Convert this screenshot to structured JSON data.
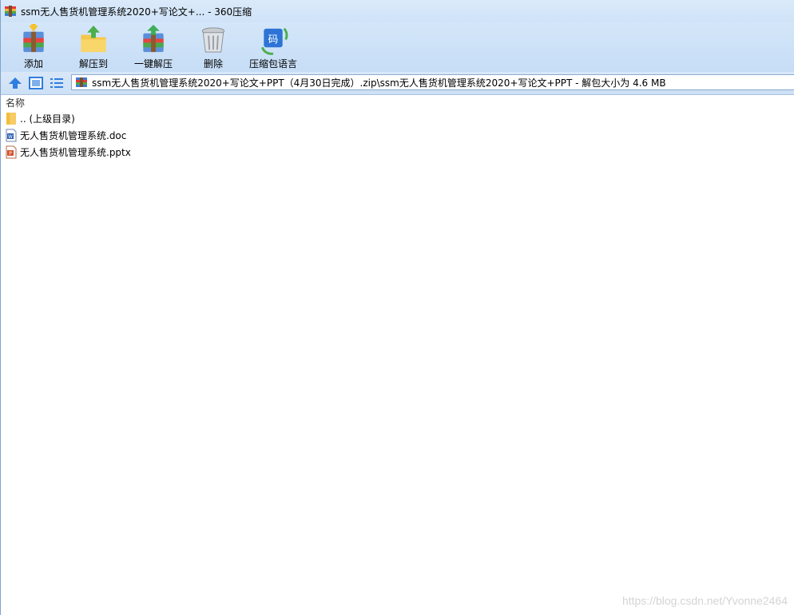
{
  "window": {
    "title": "ssm无人售货机管理系统2020+写论文+... - 360压缩",
    "icon": "archive-icon"
  },
  "toolbar": {
    "items": [
      {
        "label": "添加",
        "icon": "add-archive-icon"
      },
      {
        "label": "解压到",
        "icon": "extract-to-icon"
      },
      {
        "label": "一键解压",
        "icon": "one-click-extract-icon"
      },
      {
        "label": "删除",
        "icon": "trash-icon"
      },
      {
        "label": "压缩包语言",
        "icon": "archive-language-icon",
        "glyph": "码"
      }
    ]
  },
  "navbar": {
    "up_icon": "up-arrow-icon",
    "view_icon": "thumbnail-view-icon",
    "list_icon": "list-view-icon",
    "path": "ssm无人售货机管理系统2020+写论文+PPT（4月30日完成）.zip\\ssm无人售货机管理系统2020+写论文+PPT - 解包大小为 4.6 MB"
  },
  "file_list": {
    "column_header": "名称",
    "rows": [
      {
        "name": ".. (上级目录)",
        "icon": "folder-icon"
      },
      {
        "name": "无人售货机管理系统.doc",
        "icon": "word-doc-icon"
      },
      {
        "name": "无人售货机管理系统.pptx",
        "icon": "powerpoint-icon"
      }
    ]
  },
  "watermark": "https://blog.csdn.net/Yvonne2464",
  "colors": {
    "toolbar_bg": "#cfe3f8",
    "accent": "#2a6fd0"
  }
}
